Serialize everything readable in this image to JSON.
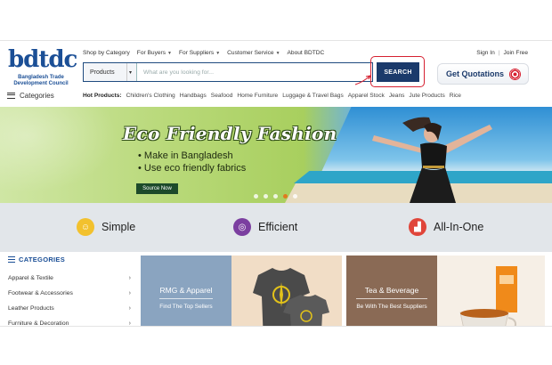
{
  "logo": {
    "mark": "bdtdc",
    "line1": "Bangladesh Trade",
    "line2": "Development Council"
  },
  "topnav": [
    {
      "label": "Shop by Category",
      "caret": false
    },
    {
      "label": "For Buyers",
      "caret": true
    },
    {
      "label": "For Suppliers",
      "caret": true
    },
    {
      "label": "Customer Service",
      "caret": true
    },
    {
      "label": "About BDTDC",
      "caret": false
    }
  ],
  "account": {
    "sign_in": "Sign In",
    "separator": "|",
    "join": "Join Free"
  },
  "search": {
    "category": "Products",
    "placeholder": "What are you looking for...",
    "button": "SEARCH"
  },
  "quotations": {
    "label": "Get Quotations",
    "icon": "target-icon"
  },
  "categories_toggle": "Categories",
  "hot_products": {
    "label": "Hot Products:",
    "items": [
      "Children's Clothing",
      "Handbags",
      "Seafood",
      "Home Furniture",
      "Luggage & Travel Bags",
      "Apparel Stock",
      "Jeans",
      "Jute Products",
      "Rice"
    ]
  },
  "banner": {
    "title": "Eco Friendly Fashion",
    "bullets": [
      "Make in Bangladesh",
      "Use eco friendly fabrics"
    ],
    "button": "Source Now"
  },
  "features": [
    {
      "label": "Simple",
      "icon": "smile-icon",
      "color": "#f2c12e"
    },
    {
      "label": "Efficient",
      "icon": "target-icon",
      "color": "#7b3fa0"
    },
    {
      "label": "All-In-One",
      "icon": "bar-chart-icon",
      "color": "#e0453a"
    }
  ],
  "categories": {
    "title": "CATEGORIES",
    "items": [
      "Apparel & Textile",
      "Footwear & Accessories",
      "Leather Products",
      "Furniture & Decoration"
    ]
  },
  "tiles": [
    {
      "title": "RMG & Apparel",
      "subtitle": "Find The Top Sellers",
      "color": "#8aa4c0"
    },
    {
      "title": "Tea & Beverage",
      "subtitle": "Be With The Best Suppliers",
      "color": "#8a6a55"
    }
  ],
  "colors": {
    "brand": "#1b4f96",
    "search_button": "#1b3a6b",
    "highlight": "#d62030"
  }
}
